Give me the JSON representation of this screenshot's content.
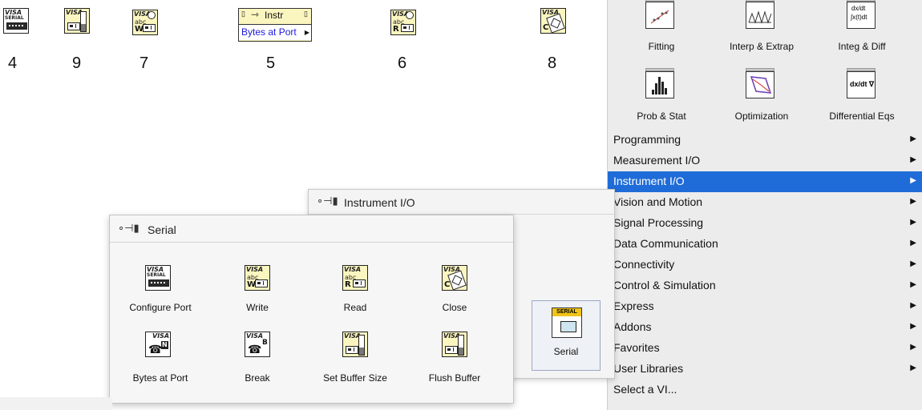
{
  "top_row": {
    "labels": [
      "4",
      "9",
      "7",
      "5",
      "6",
      "8"
    ],
    "node5": {
      "title": "Instr",
      "terminal": "Bytes at Port"
    }
  },
  "icons": {
    "visa": "VISA",
    "serial_small": "SERIAL",
    "abc": "abc",
    "write_glyph": "W",
    "read_glyph": "R",
    "close_glyph": "C",
    "break_glyph": "B",
    "bytes_glyph": "N",
    "serial_badge": "SERIAL"
  },
  "right_palette": {
    "tiles_row1": [
      "Fitting",
      "Interp & Extrap",
      "Integ & Diff"
    ],
    "tiles_row2": [
      "Prob & Stat",
      "Optimization",
      "Differential Eqs"
    ],
    "icon_text": {
      "integ": "dx/dt",
      "integ2": "∫x(t)dt",
      "diffeq": "dx/dt ∇"
    },
    "menu": [
      {
        "label": "Programming",
        "arrow": true
      },
      {
        "label": "Measurement I/O",
        "arrow": true
      },
      {
        "label": "Instrument I/O",
        "arrow": true,
        "selected": true
      },
      {
        "label": "Vision and Motion",
        "arrow": true
      },
      {
        "label": "Signal Processing",
        "arrow": true
      },
      {
        "label": "Data Communication",
        "arrow": true
      },
      {
        "label": "Connectivity",
        "arrow": true
      },
      {
        "label": "Control & Simulation",
        "arrow": true
      },
      {
        "label": "Express",
        "arrow": true
      },
      {
        "label": "Addons",
        "arrow": true
      },
      {
        "label": "Favorites",
        "arrow": true
      },
      {
        "label": "User Libraries",
        "arrow": true
      },
      {
        "label": "Select a VI...",
        "arrow": false
      }
    ],
    "arrow_glyph": "▶",
    "selected_color": "#1f6cd8"
  },
  "instrument_panel": {
    "title": "Instrument I/O",
    "serial_tile_label": "Serial"
  },
  "serial_panel": {
    "title": "Serial",
    "items_row1": [
      "Configure Port",
      "Write",
      "Read",
      "Close"
    ],
    "items_row2": [
      "Bytes at Port",
      "Break",
      "Set Buffer Size",
      "Flush Buffer"
    ]
  }
}
